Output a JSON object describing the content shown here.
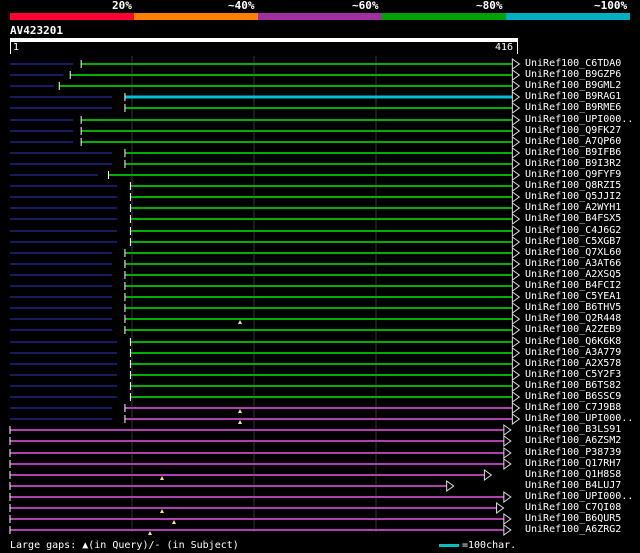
{
  "legend": {
    "labels": [
      "20%",
      "~40%",
      "~60%",
      "~80%",
      "~100%"
    ],
    "colors": [
      "#ff0033",
      "#ff7f00",
      "#a030a0",
      "#00a000",
      "#00b0c0"
    ]
  },
  "query": {
    "name": "AV423201",
    "start_label": "1",
    "end_label": "416"
  },
  "hits": [
    {
      "label": "UniRef100_C6TDA0",
      "color": "green",
      "start": 13,
      "end": 413,
      "arrow": "right"
    },
    {
      "label": "UniRef100_B9GZP6",
      "color": "green",
      "start": 11,
      "end": 413,
      "arrow": "right"
    },
    {
      "label": "UniRef100_B9GML2",
      "color": "green",
      "start": 9,
      "end": 413,
      "arrow": "right"
    },
    {
      "label": "UniRef100_B9RAG1",
      "color": "cyan",
      "start": 21,
      "end": 413,
      "arrow": "right"
    },
    {
      "label": "UniRef100_B9RME6",
      "color": "green",
      "start": 21,
      "end": 413,
      "arrow": "right"
    },
    {
      "label": "UniRef100_UPI000..",
      "color": "green",
      "start": 13,
      "end": 413,
      "arrow": "right"
    },
    {
      "label": "UniRef100_Q9FK27",
      "color": "green",
      "start": 13,
      "end": 413,
      "arrow": "right"
    },
    {
      "label": "UniRef100_A7QP60",
      "color": "green",
      "start": 13,
      "end": 413,
      "arrow": "right"
    },
    {
      "label": "UniRef100_B9IFB6",
      "color": "green",
      "start": 21,
      "end": 413,
      "arrow": "right"
    },
    {
      "label": "UniRef100_B9I3R2",
      "color": "green",
      "start": 21,
      "end": 413,
      "arrow": "right"
    },
    {
      "label": "UniRef100_Q9FYF9",
      "color": "green",
      "start": 18,
      "end": 413,
      "arrow": "right"
    },
    {
      "label": "UniRef100_Q8RZI5",
      "color": "green",
      "start": 22,
      "end": 413,
      "arrow": "right"
    },
    {
      "label": "UniRef100_Q5JJI2",
      "color": "green",
      "start": 22,
      "end": 413,
      "arrow": "right"
    },
    {
      "label": "UniRef100_A2WYH1",
      "color": "green",
      "start": 22,
      "end": 413,
      "arrow": "right"
    },
    {
      "label": "UniRef100_B4FSX5",
      "color": "green",
      "start": 22,
      "end": 413,
      "arrow": "right"
    },
    {
      "label": "UniRef100_C4J6G2",
      "color": "green",
      "start": 22,
      "end": 413,
      "arrow": "right"
    },
    {
      "label": "UniRef100_C5XGB7",
      "color": "green",
      "start": 22,
      "end": 413,
      "arrow": "right"
    },
    {
      "label": "UniRef100_Q7XL60",
      "color": "green",
      "start": 21,
      "end": 413,
      "arrow": "right"
    },
    {
      "label": "UniRef100_A3AT66",
      "color": "green",
      "start": 21,
      "end": 413,
      "arrow": "right"
    },
    {
      "label": "UniRef100_A2XSQ5",
      "color": "green",
      "start": 21,
      "end": 413,
      "arrow": "right"
    },
    {
      "label": "UniRef100_B4FCI2",
      "color": "green",
      "start": 21,
      "end": 413,
      "arrow": "right"
    },
    {
      "label": "UniRef100_C5YEA1",
      "color": "green",
      "start": 21,
      "end": 413,
      "arrow": "right"
    },
    {
      "label": "UniRef100_B6THV5",
      "color": "green",
      "start": 21,
      "end": 413,
      "arrow": "right"
    },
    {
      "label": "UniRef100_Q2R448",
      "color": "green",
      "start": 21,
      "end": 413,
      "arrow": "right",
      "gap": true
    },
    {
      "label": "UniRef100_A2ZEB9",
      "color": "green",
      "start": 21,
      "end": 413,
      "arrow": "right"
    },
    {
      "label": "UniRef100_Q6K6K8",
      "color": "green",
      "start": 22,
      "end": 413,
      "arrow": "right"
    },
    {
      "label": "UniRef100_A3A779",
      "color": "green",
      "start": 22,
      "end": 413,
      "arrow": "right"
    },
    {
      "label": "UniRef100_A2X578",
      "color": "green",
      "start": 22,
      "end": 413,
      "arrow": "right"
    },
    {
      "label": "UniRef100_C5Y2F3",
      "color": "green",
      "start": 22,
      "end": 413,
      "arrow": "right"
    },
    {
      "label": "UniRef100_B6TS82",
      "color": "green",
      "start": 22,
      "end": 413,
      "arrow": "right"
    },
    {
      "label": "UniRef100_B6SSC9",
      "color": "green",
      "start": 22,
      "end": 413,
      "arrow": "right"
    },
    {
      "label": "UniRef100_C7J9B8",
      "color": "purple",
      "start": 21,
      "end": 413,
      "arrow": "right",
      "gap": true
    },
    {
      "label": "UniRef100_UPI000..",
      "color": "purple",
      "start": 21,
      "end": 413,
      "arrow": "right",
      "gap": true
    },
    {
      "label": "UniRef100_B3LS91",
      "color": "purple",
      "start": 1,
      "end": 406,
      "arrow": "right"
    },
    {
      "label": "UniRef100_A6ZSM2",
      "color": "purple",
      "start": 1,
      "end": 406,
      "arrow": "right"
    },
    {
      "label": "UniRef100_P38739",
      "color": "purple",
      "start": 1,
      "end": 406,
      "arrow": "right"
    },
    {
      "label": "UniRef100_Q17RH7",
      "color": "purple",
      "start": 1,
      "end": 406,
      "arrow": "right"
    },
    {
      "label": "UniRef100_Q1H8S8",
      "color": "purple",
      "start": 1,
      "end": 390,
      "arrow": "right",
      "gap": true
    },
    {
      "label": "UniRef100_B4LUJ7",
      "color": "purple",
      "start": 1,
      "end": 359,
      "arrow": "right"
    },
    {
      "label": "UniRef100_UPI000..",
      "color": "purple",
      "start": 1,
      "end": 406,
      "arrow": "right"
    },
    {
      "label": "UniRef100_C7QI08",
      "color": "purple",
      "start": 1,
      "end": 400,
      "arrow": "right",
      "gap": true
    },
    {
      "label": "UniRef100_B6QUR5",
      "color": "purple",
      "start": 1,
      "end": 406,
      "arrow": "right",
      "gap": true
    },
    {
      "label": "UniRef100_A6ZRG2",
      "color": "purple",
      "start": 1,
      "end": 406,
      "arrow": "right",
      "gap": true
    }
  ],
  "footer": {
    "gaps_text": "Large gaps: ▲(in Query)/- (in Subject)",
    "scale_text": "=100char."
  }
}
